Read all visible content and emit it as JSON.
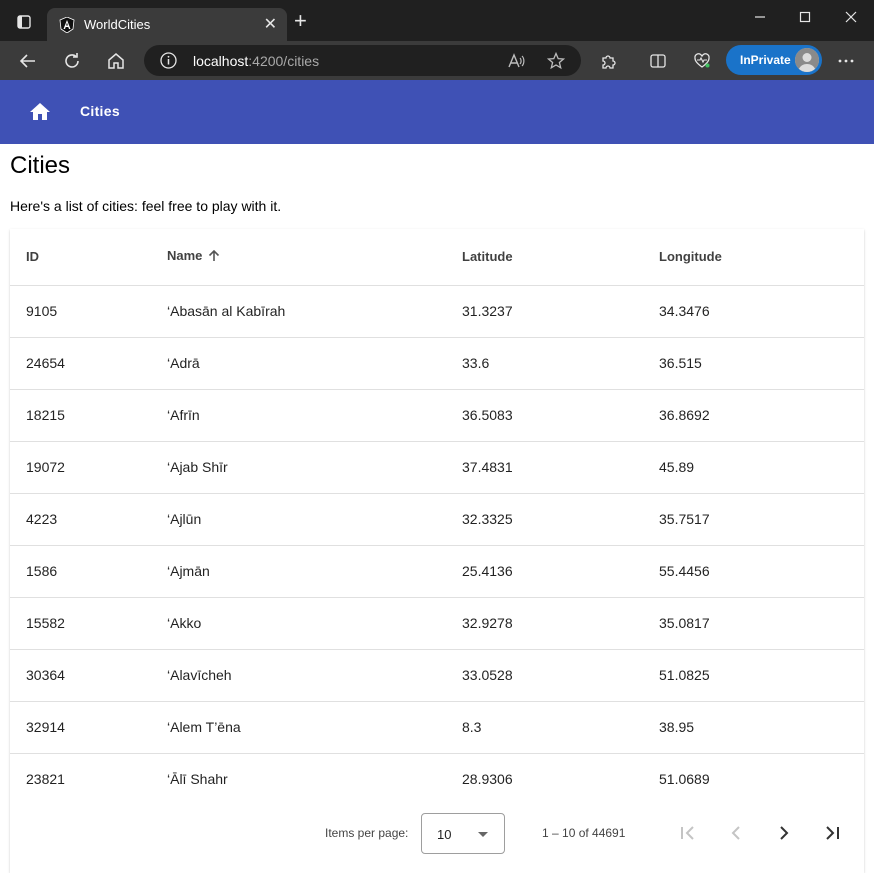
{
  "browser": {
    "tab_title": "WorldCities",
    "url_host": "localhost",
    "url_rest": ":4200/cities",
    "inprivate_label": "InPrivate"
  },
  "app": {
    "nav_link": "Cities",
    "page_title": "Cities",
    "intro": "Here's a list of cities: feel free to play with it."
  },
  "table": {
    "headers": [
      "ID",
      "Name",
      "Latitude",
      "Longitude"
    ],
    "sort": {
      "column": "Name",
      "direction": "asc"
    },
    "rows": [
      [
        "9105",
        "‘Abasān al Kabīrah",
        "31.3237",
        "34.3476"
      ],
      [
        "24654",
        "‘Adrā",
        "33.6",
        "36.515"
      ],
      [
        "18215",
        "‘Afrīn",
        "36.5083",
        "36.8692"
      ],
      [
        "19072",
        "‘Ajab Shīr",
        "37.4831",
        "45.89"
      ],
      [
        "4223",
        "‘Ajlūn",
        "32.3325",
        "35.7517"
      ],
      [
        "1586",
        "‘Ajmān",
        "25.4136",
        "55.4456"
      ],
      [
        "15582",
        "‘Akko",
        "32.9278",
        "35.0817"
      ],
      [
        "30364",
        "‘Alavīcheh",
        "33.0528",
        "51.0825"
      ],
      [
        "32914",
        "‘Alem T’ēna",
        "8.3",
        "38.95"
      ],
      [
        "23821",
        "‘Ālī Shahr",
        "28.9306",
        "51.0689"
      ]
    ]
  },
  "paginator": {
    "items_per_page_label": "Items per page:",
    "page_size": "10",
    "range_label": "1 – 10 of 44691"
  },
  "colors": {
    "app_bar": "#3f51b5",
    "inprivate": "#1a73c9"
  }
}
